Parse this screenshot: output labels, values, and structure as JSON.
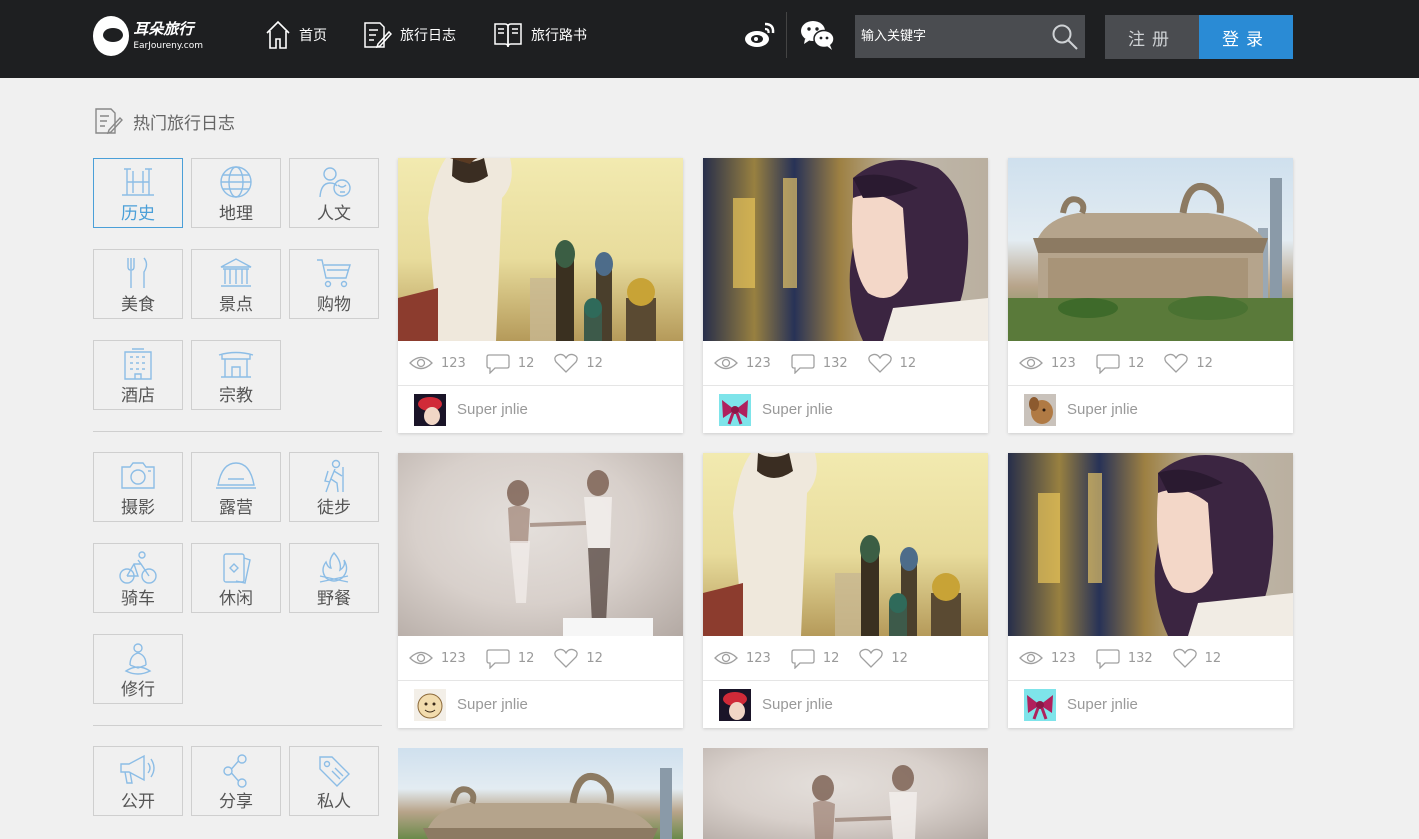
{
  "header": {
    "logo_cn": "耳朵旅行",
    "logo_en": "EarJoureny.com",
    "nav": [
      {
        "label": "首页"
      },
      {
        "label": "旅行日志"
      },
      {
        "label": "旅行路书"
      }
    ],
    "search_placeholder": "输入关键字",
    "register_label": "注册",
    "login_label": "登录"
  },
  "section_title": "热门旅行日志",
  "categories": {
    "group1": [
      {
        "label": "历史",
        "icon": "history-icon",
        "active": true
      },
      {
        "label": "地理",
        "icon": "globe-icon"
      },
      {
        "label": "人文",
        "icon": "culture-icon"
      },
      {
        "label": "美食",
        "icon": "food-icon"
      },
      {
        "label": "景点",
        "icon": "landmark-icon"
      },
      {
        "label": "购物",
        "icon": "cart-icon"
      },
      {
        "label": "酒店",
        "icon": "hotel-icon"
      },
      {
        "label": "宗教",
        "icon": "temple-icon"
      }
    ],
    "group2": [
      {
        "label": "摄影",
        "icon": "camera-icon"
      },
      {
        "label": "露营",
        "icon": "tent-icon"
      },
      {
        "label": "徒步",
        "icon": "hiker-icon"
      },
      {
        "label": "骑车",
        "icon": "bicycle-icon"
      },
      {
        "label": "休闲",
        "icon": "cards-icon"
      },
      {
        "label": "野餐",
        "icon": "campfire-icon"
      },
      {
        "label": "修行",
        "icon": "meditation-icon"
      }
    ],
    "group3": [
      {
        "label": "公开",
        "icon": "megaphone-icon"
      },
      {
        "label": "分享",
        "icon": "share-icon"
      },
      {
        "label": "私人",
        "icon": "tag-icon"
      }
    ]
  },
  "cards": [
    {
      "views": "123",
      "comments": "12",
      "likes": "12",
      "author": "Super jnlie",
      "photo": "girl-church",
      "avatar": "red-hat"
    },
    {
      "views": "123",
      "comments": "132",
      "likes": "12",
      "author": "Super jnlie",
      "photo": "girl-hair",
      "avatar": "bow"
    },
    {
      "views": "123",
      "comments": "12",
      "likes": "12",
      "author": "Super jnlie",
      "photo": "museum",
      "avatar": "dog"
    },
    {
      "views": "123",
      "comments": "12",
      "likes": "12",
      "author": "Super jnlie",
      "photo": "couple",
      "avatar": "cartoon"
    },
    {
      "views": "123",
      "comments": "12",
      "likes": "12",
      "author": "Super jnlie",
      "photo": "girl-church",
      "avatar": "red-hat"
    },
    {
      "views": "123",
      "comments": "132",
      "likes": "12",
      "author": "Super jnlie",
      "photo": "girl-hair",
      "avatar": "bow"
    }
  ],
  "colors": {
    "header_bg": "#1e1f21",
    "accent": "#2a8bd5",
    "category_active": "#4a9fd8"
  }
}
